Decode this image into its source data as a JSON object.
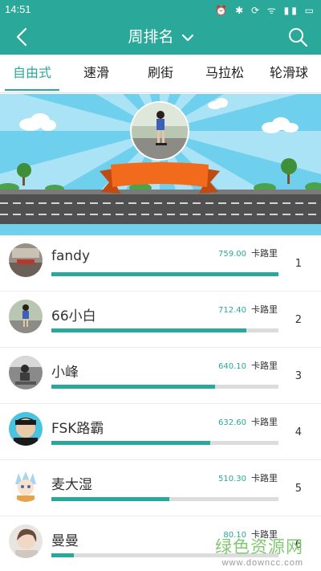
{
  "status_bar": {
    "time": "14:51",
    "icons": "⏰ ✱ ⟳ ᯤ ▮▮ ▭"
  },
  "app_bar": {
    "title": "周排名"
  },
  "tabs": [
    {
      "label": "自由式",
      "active": true
    },
    {
      "label": "速滑",
      "active": false
    },
    {
      "label": "刷街",
      "active": false
    },
    {
      "label": "马拉松",
      "active": false
    },
    {
      "label": "轮滑球",
      "active": false
    }
  ],
  "colors": {
    "accent": "#2aa89a",
    "track": "#dcdcdc",
    "ribbon": "#f26a1b"
  },
  "distance_unit": "卡路里",
  "rankings": [
    {
      "rank": "1",
      "name": "fandy",
      "value": "759.00",
      "fraction": 1.0
    },
    {
      "rank": "2",
      "name": "66小白",
      "value": "712.40",
      "fraction": 0.86
    },
    {
      "rank": "3",
      "name": "小峰",
      "value": "640.10",
      "fraction": 0.72
    },
    {
      "rank": "4",
      "name": "FSK路霸",
      "value": "632.60",
      "fraction": 0.7
    },
    {
      "rank": "5",
      "name": "麦大湿",
      "value": "510.30",
      "fraction": 0.52
    },
    {
      "rank": "6",
      "name": "曼曼",
      "value": "80.10",
      "fraction": 0.1
    }
  ],
  "watermark": {
    "main": "绿色资源网",
    "sub": "www.downcc.com"
  }
}
